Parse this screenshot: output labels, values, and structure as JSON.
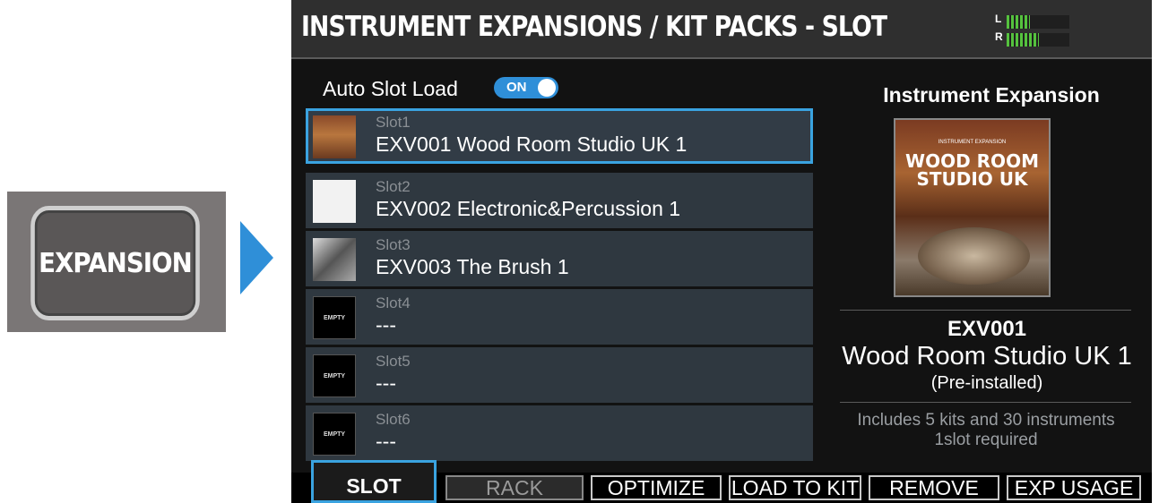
{
  "hardware_button": {
    "label": "EXPANSION"
  },
  "header": {
    "title": "INSTRUMENT EXPANSIONS / KIT PACKS - SLOT",
    "meter_left": "L",
    "meter_right": "R"
  },
  "auto_slot_load": {
    "label": "Auto Slot Load",
    "state": "ON"
  },
  "slots": [
    {
      "slot": "Slot1",
      "name": "EXV001  Wood Room Studio UK 1",
      "thumb": "expansion-cover"
    },
    {
      "slot": "Slot2",
      "name": "EXV002 Electronic&Percussion 1",
      "thumb": "expansion-cover"
    },
    {
      "slot": "Slot3",
      "name": "EXV003 The Brush 1",
      "thumb": "expansion-cover"
    },
    {
      "slot": "Slot4",
      "name": "---",
      "thumb": "EMPTY"
    },
    {
      "slot": "Slot5",
      "name": "---",
      "thumb": "EMPTY"
    },
    {
      "slot": "Slot6",
      "name": "---",
      "thumb": "EMPTY"
    }
  ],
  "detail": {
    "heading": "Instrument Expansion",
    "cover_small": "INSTRUMENT EXPANSION",
    "cover_title": "WOOD ROOM STUDIO UK",
    "code": "EXV001",
    "name": "Wood Room Studio UK 1",
    "status": "(Pre-installed)",
    "includes": "Includes 5 kits and 30 instruments",
    "required": "1slot required"
  },
  "tabs": [
    "SLOT",
    "RACK",
    "OPTIMIZE",
    "LOAD TO KIT",
    "REMOVE",
    "EXP USAGE"
  ],
  "colors": {
    "accent": "#2f8fd8",
    "meter": "#55c23e"
  }
}
